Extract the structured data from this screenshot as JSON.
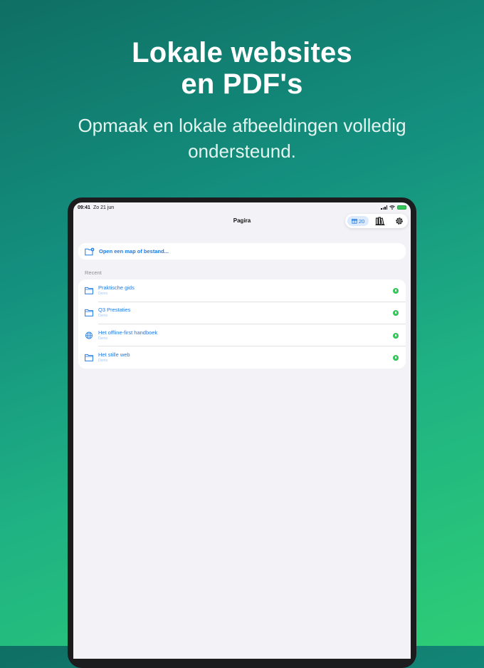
{
  "headline": {
    "line1": "Lokale websites",
    "line2": "en PDF's"
  },
  "subhead": {
    "line1": "Opmaak en lokale afbeeldingen volledig",
    "line2": "ondersteund."
  },
  "status_bar": {
    "time": "09:41",
    "date": "Zo 21 jun"
  },
  "nav": {
    "title": "Pagira"
  },
  "toolbar": {
    "badge_count": "20",
    "badge_icon": "gift-icon",
    "library_icon": "library-icon",
    "settings_icon": "gear-icon"
  },
  "open": {
    "label": "Open een map of bestand..."
  },
  "recent": {
    "heading": "Recent",
    "items": [
      {
        "title": "Praktische gids",
        "subtitle": "Demo",
        "icon": "folder-icon"
      },
      {
        "title": "Q3 Prestaties",
        "subtitle": "Demo",
        "icon": "folder-icon"
      },
      {
        "title": "Het offline-first handboek",
        "subtitle": "Demo",
        "icon": "globe-icon"
      },
      {
        "title": "Het stille web",
        "subtitle": "Demo",
        "icon": "folder-icon"
      }
    ]
  },
  "colors": {
    "accent": "#1f7ae0",
    "status_green": "#34c759",
    "background_top": "#0f6f64",
    "background_bottom": "#2dcd76"
  }
}
